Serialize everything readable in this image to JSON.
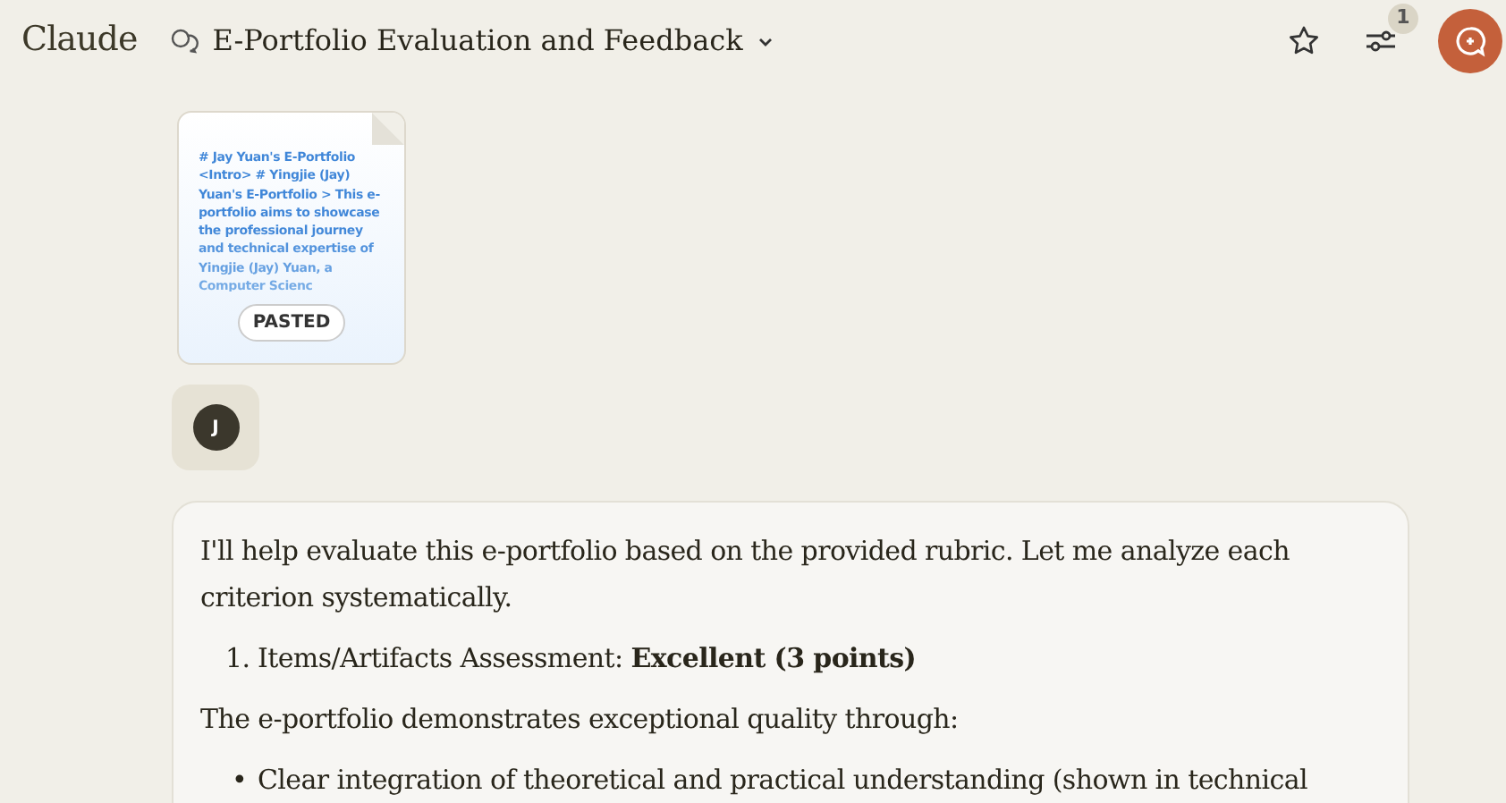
{
  "header": {
    "logo": "Claude",
    "title": "E-Portfolio Evaluation and Feedback",
    "badge": "1"
  },
  "attachment": {
    "preview": "# Jay Yuan's E-Portfolio <Intro> # Yingjie (Jay) Yuan's E-Portfolio > This e-portfolio aims to showcase the professional journey and technical expertise of Yingjie (Jay) Yuan, a Computer Scienc",
    "tag": "PASTED"
  },
  "user": {
    "initial": "J"
  },
  "response": [
    {
      "kind": "paragraph",
      "text": "I'll help evaluate this e-portfolio based on the provided rubric. Let me analyze each criterion systematically."
    },
    {
      "kind": "numbered",
      "marker": "1.",
      "text": "Items/Artifacts Assessment: **Excellent (3 points)**"
    },
    {
      "kind": "paragraph",
      "text": "The e-portfolio demonstrates exceptional quality through:"
    },
    {
      "kind": "bullet",
      "marker": "•",
      "text": "Clear integration of theoretical and practical understanding (shown in technical"
    }
  ]
}
